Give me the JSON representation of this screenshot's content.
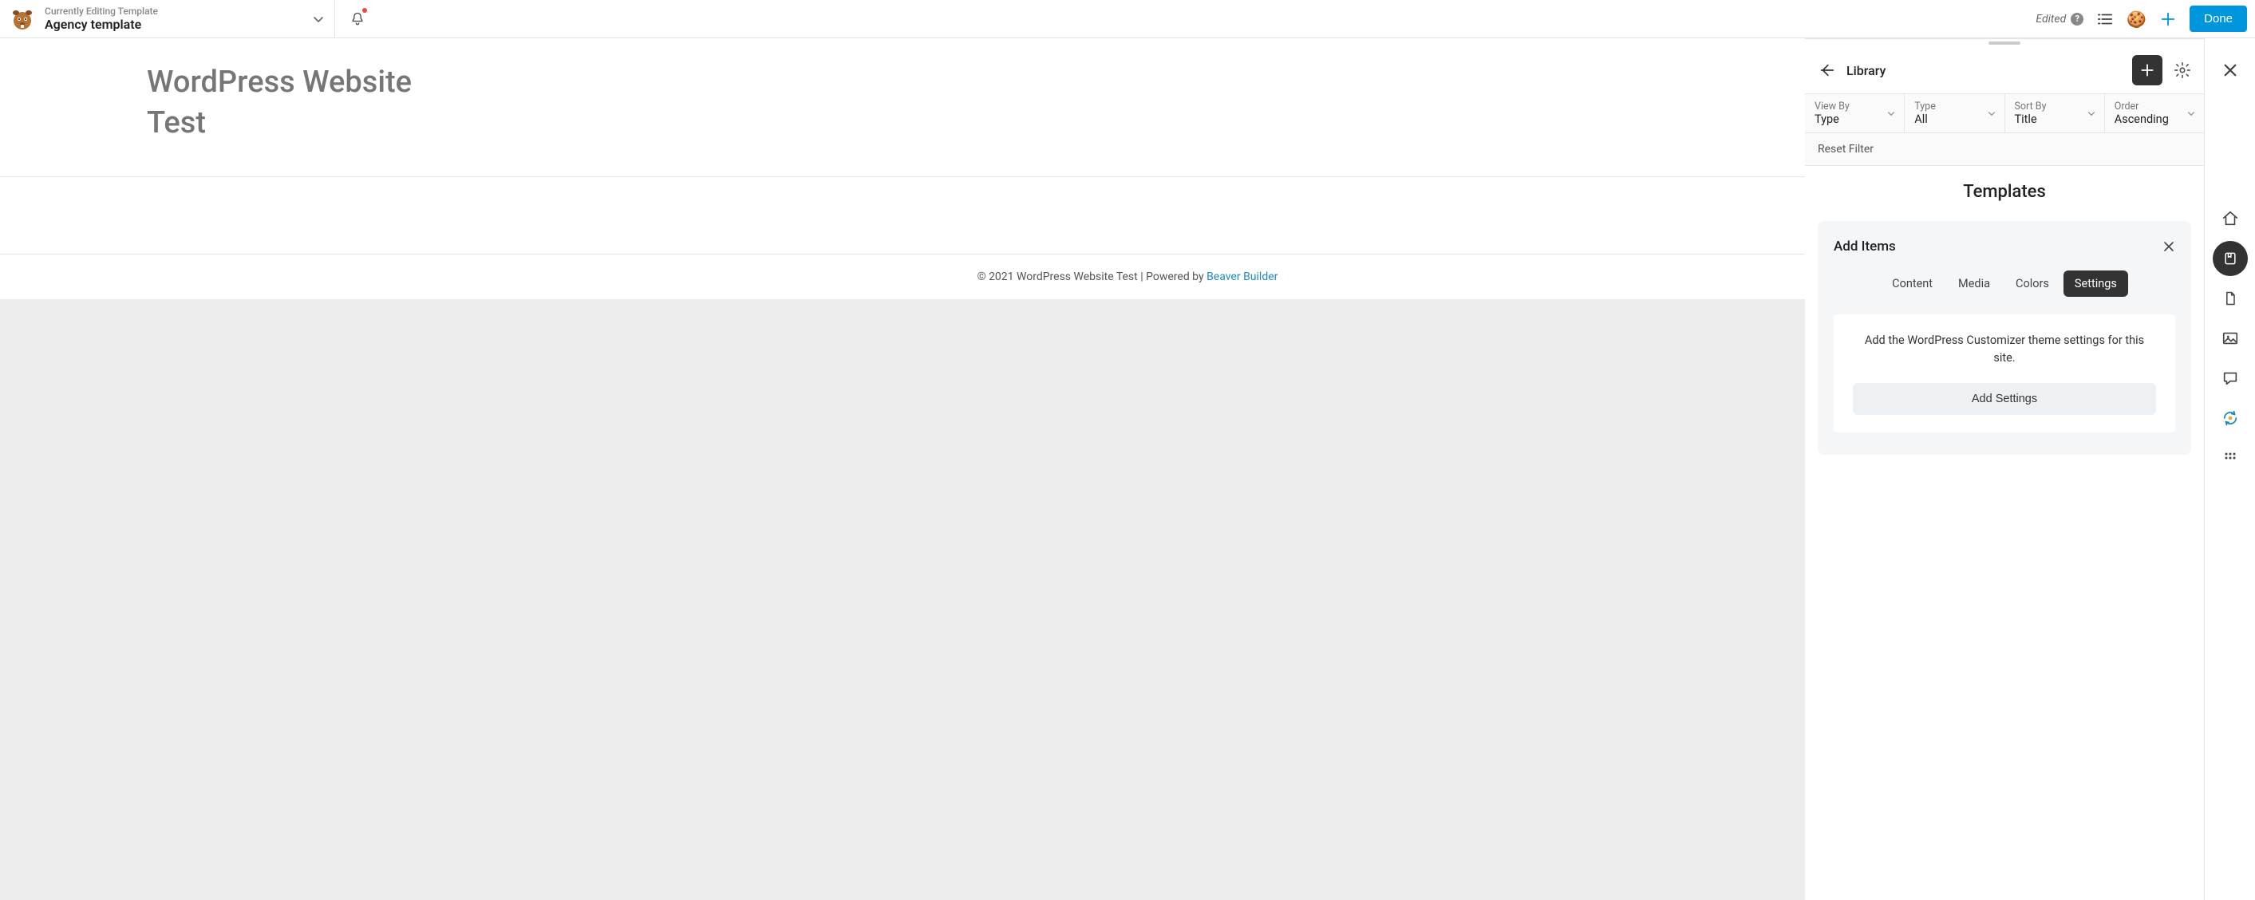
{
  "topbar": {
    "subtitle": "Currently Editing Template",
    "title": "Agency template",
    "edited_label": "Edited",
    "done_label": "Done"
  },
  "page": {
    "heading_line1": "WordPress Website",
    "heading_line2": "Test",
    "footer_copyright": "© 2021 WordPress Website Test | Powered by ",
    "footer_link": "Beaver Builder"
  },
  "library": {
    "title": "Library",
    "filters": {
      "view_by_label": "View By",
      "view_by_value": "Type",
      "type_label": "Type",
      "type_value": "All",
      "sort_by_label": "Sort By",
      "sort_by_value": "Title",
      "order_label": "Order",
      "order_value": "Ascending"
    },
    "reset_filter": "Reset Filter",
    "section_title": "Templates",
    "add_items": {
      "title": "Add Items",
      "tabs": {
        "content": "Content",
        "media": "Media",
        "colors": "Colors",
        "settings": "Settings"
      },
      "settings_desc": "Add the WordPress Customizer theme settings for this site.",
      "add_settings_label": "Add Settings"
    }
  }
}
